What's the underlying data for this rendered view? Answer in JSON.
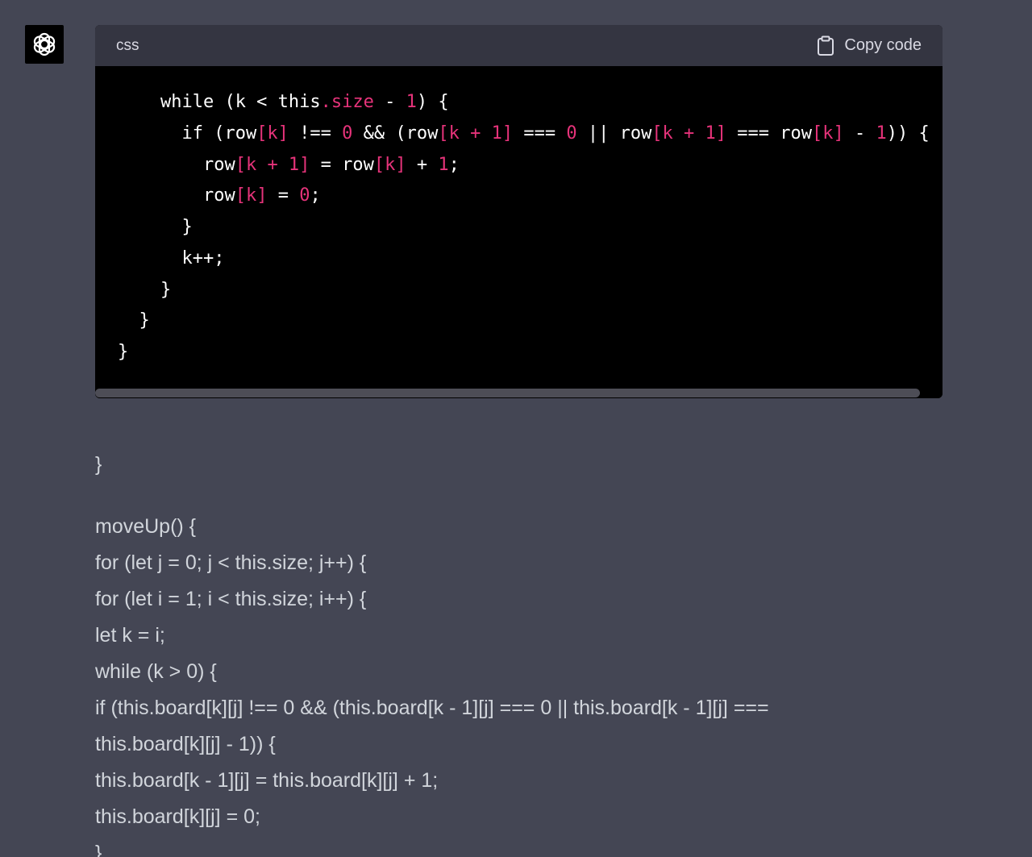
{
  "code_block": {
    "language": "css",
    "copy_label": "Copy code",
    "lines": [
      [
        {
          "t": "    while (k < this",
          "c": "plain"
        },
        {
          "t": ".size",
          "c": "pink"
        },
        {
          "t": " - ",
          "c": "plain"
        },
        {
          "t": "1",
          "c": "pink"
        },
        {
          "t": ") {",
          "c": "plain"
        }
      ],
      [
        {
          "t": "      if (row",
          "c": "plain"
        },
        {
          "t": "[k]",
          "c": "pink"
        },
        {
          "t": " !== ",
          "c": "plain"
        },
        {
          "t": "0",
          "c": "pink"
        },
        {
          "t": " && (row",
          "c": "plain"
        },
        {
          "t": "[k + 1]",
          "c": "pink"
        },
        {
          "t": " === ",
          "c": "plain"
        },
        {
          "t": "0",
          "c": "pink"
        },
        {
          "t": " || row",
          "c": "plain"
        },
        {
          "t": "[k + 1]",
          "c": "pink"
        },
        {
          "t": " === row",
          "c": "plain"
        },
        {
          "t": "[k]",
          "c": "pink"
        },
        {
          "t": " - ",
          "c": "plain"
        },
        {
          "t": "1",
          "c": "pink"
        },
        {
          "t": ")) {",
          "c": "plain"
        }
      ],
      [
        {
          "t": "        row",
          "c": "plain"
        },
        {
          "t": "[k + 1]",
          "c": "pink"
        },
        {
          "t": " = row",
          "c": "plain"
        },
        {
          "t": "[k]",
          "c": "pink"
        },
        {
          "t": " + ",
          "c": "plain"
        },
        {
          "t": "1",
          "c": "pink"
        },
        {
          "t": ";",
          "c": "plain"
        }
      ],
      [
        {
          "t": "        row",
          "c": "plain"
        },
        {
          "t": "[k]",
          "c": "pink"
        },
        {
          "t": " = ",
          "c": "plain"
        },
        {
          "t": "0",
          "c": "pink"
        },
        {
          "t": ";",
          "c": "plain"
        }
      ],
      [
        {
          "t": "      }",
          "c": "plain"
        }
      ],
      [
        {
          "t": "      k++;",
          "c": "plain"
        }
      ],
      [
        {
          "t": "    }",
          "c": "plain"
        }
      ],
      [
        {
          "t": "  }",
          "c": "plain"
        }
      ],
      [
        {
          "t": "}",
          "c": "plain"
        }
      ]
    ]
  },
  "prose": {
    "closing_brace": "}",
    "lines": [
      "moveUp() {",
      "for (let j = 0; j < this.size; j++) {",
      "for (let i = 1; i < this.size; i++) {",
      "let k = i;",
      "while (k > 0) {",
      "if (this.board[k][j] !== 0 && (this.board[k - 1][j] === 0 || this.board[k - 1][j] ===",
      "this.board[k][j] - 1)) {",
      "this.board[k - 1][j] = this.board[k][j] + 1;",
      "this.board[k][j] = 0;",
      "}"
    ]
  }
}
